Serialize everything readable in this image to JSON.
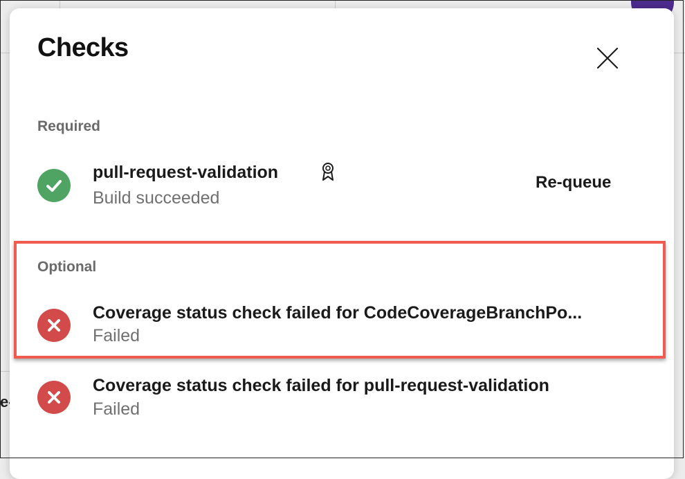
{
  "dialog": {
    "title": "Checks",
    "close_icon": "close-icon"
  },
  "required": {
    "label": "Required",
    "checks": [
      {
        "name": "pull-request-validation",
        "status": "Build succeeded",
        "state": "succeeded",
        "state_icon": "check-circle-icon",
        "badge_icon": "award-ribbon-icon",
        "action_label": "Re-queue"
      }
    ]
  },
  "optional": {
    "label": "Optional",
    "checks": [
      {
        "name": "Coverage status check failed for CodeCoverageBranchPo...",
        "status": "Failed",
        "state": "failed",
        "state_icon": "x-circle-icon"
      },
      {
        "name": "Coverage status check failed for pull-request-validation",
        "status": "Failed",
        "state": "failed",
        "state_icon": "x-circle-icon"
      }
    ]
  },
  "colors": {
    "success": "#4fa464",
    "failure": "#d24a4a",
    "highlight": "#f05a4f",
    "muted_text": "#707070",
    "avatar": "#4b2b8c"
  }
}
